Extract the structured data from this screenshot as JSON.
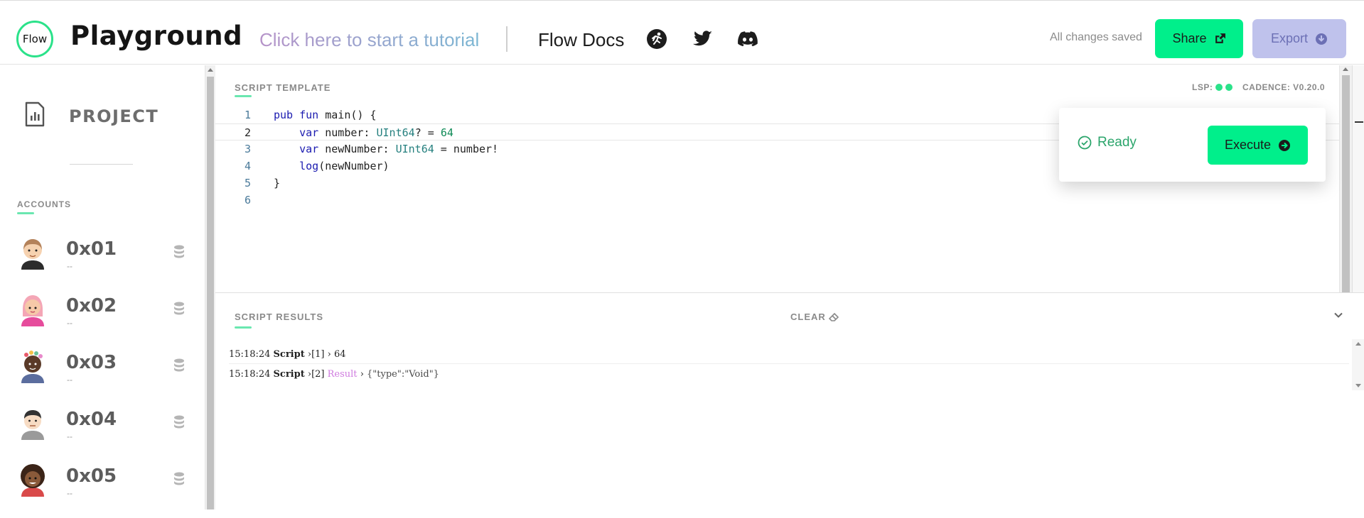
{
  "header": {
    "logo_text": "Flow",
    "title": "Playground",
    "tutorial_link": "Click here to start a tutorial",
    "docs_link": "Flow Docs",
    "icons": [
      "runner-icon",
      "twitter-icon",
      "discord-icon"
    ],
    "status": "All changes saved",
    "share_label": "Share",
    "export_label": "Export"
  },
  "sidebar": {
    "project_label": "PROJECT",
    "accounts_label": "ACCOUNTS",
    "accounts": [
      {
        "address": "0x01",
        "subtitle": "--"
      },
      {
        "address": "0x02",
        "subtitle": "--"
      },
      {
        "address": "0x03",
        "subtitle": "--"
      },
      {
        "address": "0x04",
        "subtitle": "--"
      },
      {
        "address": "0x05",
        "subtitle": "--"
      }
    ]
  },
  "editor": {
    "section_label": "SCRIPT TEMPLATE",
    "lsp_label": "LSP:",
    "cadence_label": "CADENCE: V0.20.0",
    "line_numbers": [
      "1",
      "2",
      "3",
      "4",
      "5",
      "6"
    ],
    "code": [
      "pub fun main() {",
      "    var number: UInt64? = 64",
      "    var newNumber: UInt64 = number!",
      "    log(newNumber)",
      "}",
      ""
    ],
    "status": "Ready",
    "execute_label": "Execute"
  },
  "results": {
    "section_label": "SCRIPT RESULTS",
    "clear_label": "CLEAR",
    "log": [
      {
        "time": "15:18:24",
        "source": "Script",
        "index": "[1]",
        "tag": "",
        "value": "64"
      },
      {
        "time": "15:18:24",
        "source": "Script",
        "index": "[2]",
        "tag": "Result",
        "value": "{\"type\":\"Void\"}"
      }
    ]
  },
  "colors": {
    "accent": "#00ef8b",
    "export_bg": "#bfc2ec",
    "ready": "#2ba56b",
    "result_tag": "#cf7adf"
  }
}
